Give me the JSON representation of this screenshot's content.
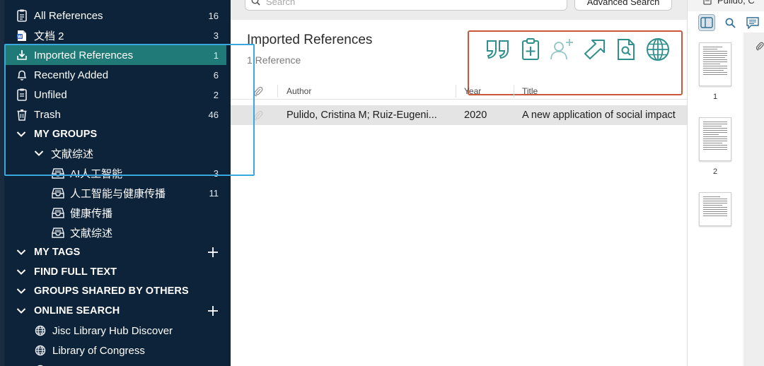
{
  "sidebar": {
    "all_refs": {
      "label": "All References",
      "count": "16"
    },
    "doc2": {
      "label": "文档 2",
      "count": "3"
    },
    "imported": {
      "label": "Imported References",
      "count": "1"
    },
    "recent": {
      "label": "Recently Added",
      "count": "6"
    },
    "unfiled": {
      "label": "Unfiled",
      "count": "2"
    },
    "trash": {
      "label": "Trash",
      "count": "46"
    },
    "my_groups": "MY GROUPS",
    "group_set": "文献综述",
    "groups": [
      {
        "label": "AI人工智能",
        "count": "3"
      },
      {
        "label": "人工智能与健康传播",
        "count": "11"
      },
      {
        "label": "健康传播",
        "count": ""
      },
      {
        "label": "文献综述",
        "count": ""
      }
    ],
    "my_tags": "MY TAGS",
    "find_full_text": "FIND FULL TEXT",
    "groups_shared": "GROUPS SHARED BY OTHERS",
    "online_search": "ONLINE SEARCH",
    "online_items": [
      {
        "label": "Jisc Library Hub Discover"
      },
      {
        "label": "Library of Congress"
      }
    ]
  },
  "main": {
    "search_placeholder": "Search",
    "advanced_search": "Advanced Search",
    "group_title": "Imported References",
    "ref_count": "1 Reference",
    "columns": {
      "author": "Author",
      "year": "Year",
      "title": "Title"
    },
    "rows": [
      {
        "author": "Pulido, Cristina M; Ruiz-Eugeni...",
        "year": "2020",
        "title": "A new application of social impact"
      }
    ]
  },
  "toolbar_icons": [
    "quote-icon",
    "clipboard-add-icon",
    "add-person-icon",
    "share-arrow-icon",
    "find-pdf-icon",
    "globe-icon"
  ],
  "pdf": {
    "tab_label": "Pulido, C",
    "pages": [
      "1",
      "2"
    ]
  },
  "colors": {
    "sidebar_bg": "#0d2339",
    "selected": "#1f7a78",
    "accent_teal": "#2f8f8c",
    "annotation_red": "#c9573c",
    "annotation_blue": "#3aa7de"
  }
}
